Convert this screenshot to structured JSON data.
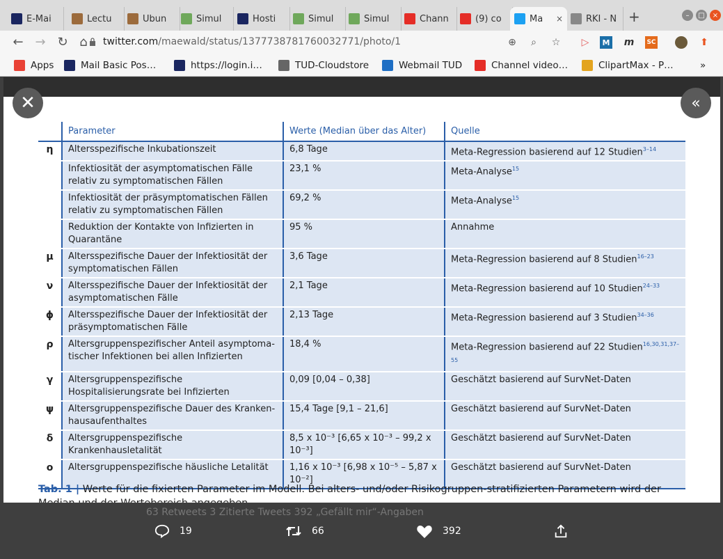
{
  "browser": {
    "tabs": [
      {
        "label": "E-Mai",
        "icon": "i-square-icon",
        "color": "#1a2660"
      },
      {
        "label": "Lectu",
        "icon": "image-icon",
        "color": "#9c6b3c"
      },
      {
        "label": "Übun",
        "icon": "image-icon",
        "color": "#9c6b3c"
      },
      {
        "label": "Simul",
        "icon": "virus-icon",
        "color": "#6fa85b"
      },
      {
        "label": "Hosti",
        "icon": "i-square-icon",
        "color": "#1a2660"
      },
      {
        "label": "Simul",
        "icon": "virus-icon",
        "color": "#6fa85b"
      },
      {
        "label": "Simul",
        "icon": "virus-icon",
        "color": "#6fa85b"
      },
      {
        "label": "Chann",
        "icon": "youtube-icon",
        "color": "#e52d27"
      },
      {
        "label": "(9) co",
        "icon": "youtube-icon",
        "color": "#e52d27"
      },
      {
        "label": "Ma",
        "icon": "twitter-icon",
        "color": "#1da1f2",
        "active": true
      },
      {
        "label": "RKI - N",
        "icon": "rki-icon",
        "color": "#888888"
      }
    ],
    "url_host": "twitter.com",
    "url_path": "/maewald/status/1377738781760032771/photo/1",
    "bookmarks": [
      {
        "label": "Apps",
        "icon": "apps-grid-icon"
      },
      {
        "label": "Mail Basic Pos…",
        "icon": "i-square-icon"
      },
      {
        "label": "https://login.i…",
        "icon": "i-square-icon"
      },
      {
        "label": "TUD-Cloudstore",
        "icon": "cloud-icon"
      },
      {
        "label": "Webmail TUD",
        "icon": "outlook-icon"
      },
      {
        "label": "Channel video…",
        "icon": "youtube-icon"
      },
      {
        "label": "ClipartMax - P…",
        "icon": "clipartmax-icon"
      }
    ],
    "more_bookmarks": "»"
  },
  "table": {
    "headers": [
      "",
      "Parameter",
      "Werte (Median über das Alter)",
      "Quelle"
    ],
    "rows": [
      {
        "sym": "η",
        "param": "Altersspezifische Inkubationszeit",
        "value": "6,8 Tage",
        "source": "Meta-Regression basierend auf 12 Studien",
        "ref": "3–14"
      },
      {
        "sym": "",
        "param": "Infektiosität der asymptomatischen Fälle relativ zu symptomatischen Fällen",
        "value": "23,1 %",
        "source": "Meta-Analyse",
        "ref": "15"
      },
      {
        "sym": "",
        "param": "Infektiosität der präsymptomatischen Fällen relativ zu symptomatischen Fällen",
        "value": "69,2 %",
        "source": "Meta-Analyse",
        "ref": "15"
      },
      {
        "sym": "",
        "param": "Reduktion der Kontakte von Infizierten in Quarantäne",
        "value": "95 %",
        "source": "Annahme",
        "ref": ""
      },
      {
        "sym": "μ",
        "param": "Altersspezifische Dauer der Infektiosität der symptomatischen Fällen",
        "value": "3,6 Tage",
        "source": "Meta-Regression basierend auf 8 Studien",
        "ref": "16–23"
      },
      {
        "sym": "ν",
        "param": "Altersspezifische Dauer der Infektiosität der asymptomatischen Fälle",
        "value": "2,1 Tage",
        "source": "Meta-Regression basierend auf 10 Studien",
        "ref": "24–33"
      },
      {
        "sym": "ϕ",
        "param": "Altersspezifische Dauer der Infektiosität der präsymptomatischen Fälle",
        "value": "2,13 Tage",
        "source": "Meta-Regression basierend auf 3 Studien",
        "ref": "34–36"
      },
      {
        "sym": "ρ",
        "param": "Altersgruppenspezifischer Anteil asymptoma-tischer Infektionen bei allen Infizierten",
        "value": "18,4 %",
        "source": "Meta-Regression basierend auf 22 Studien",
        "ref": "16,30,31,37–55"
      },
      {
        "sym": "γ",
        "param": "Altersgruppenspezifische Hospitalisierungsrate bei Infizierten",
        "value": "0,09 [0,04 – 0,38]",
        "source": "Geschätzt basierend auf SurvNet-Daten",
        "ref": ""
      },
      {
        "sym": "ψ",
        "param": "Altersgruppenspezifische Dauer des Kranken-hausaufenthaltes",
        "value": "15,4 Tage [9,1 – 21,6]",
        "source": "Geschätzt basierend auf SurvNet-Daten",
        "ref": ""
      },
      {
        "sym": "δ",
        "param": "Altersgruppenspezifische Krankenhausletalität",
        "value": "8,5 x 10⁻³ [6,65 x 10⁻³ – 99,2 x 10⁻³]",
        "source": "Geschätzt basierend auf SurvNet-Daten",
        "ref": ""
      },
      {
        "sym": "o",
        "param": "Altersgruppenspezifische häusliche Letalität",
        "value": "1,16 x 10⁻³ [6,98 x 10⁻⁵ – 5,87 x 10⁻²]",
        "source": "Geschätzt basierend auf SurvNet-Daten",
        "ref": ""
      }
    ]
  },
  "caption": {
    "label": "Tab. 1 |",
    "text": " Werte für die fixierten Parameter im Modell. Bei alters- und/oder Risikogruppen-stratifizierten Parametern wird der Median und der Wertebereich angegeben."
  },
  "stats_faded": "63 Retweets    3 Zitierte Tweets    392 „Gefällt mir“-Angaben",
  "actions": {
    "replies": "19",
    "retweets": "66",
    "likes": "392"
  },
  "colors": {
    "accent_blue": "#2a5ea8",
    "row_fill": "#dde6f3",
    "like_white": "#ffffff"
  }
}
